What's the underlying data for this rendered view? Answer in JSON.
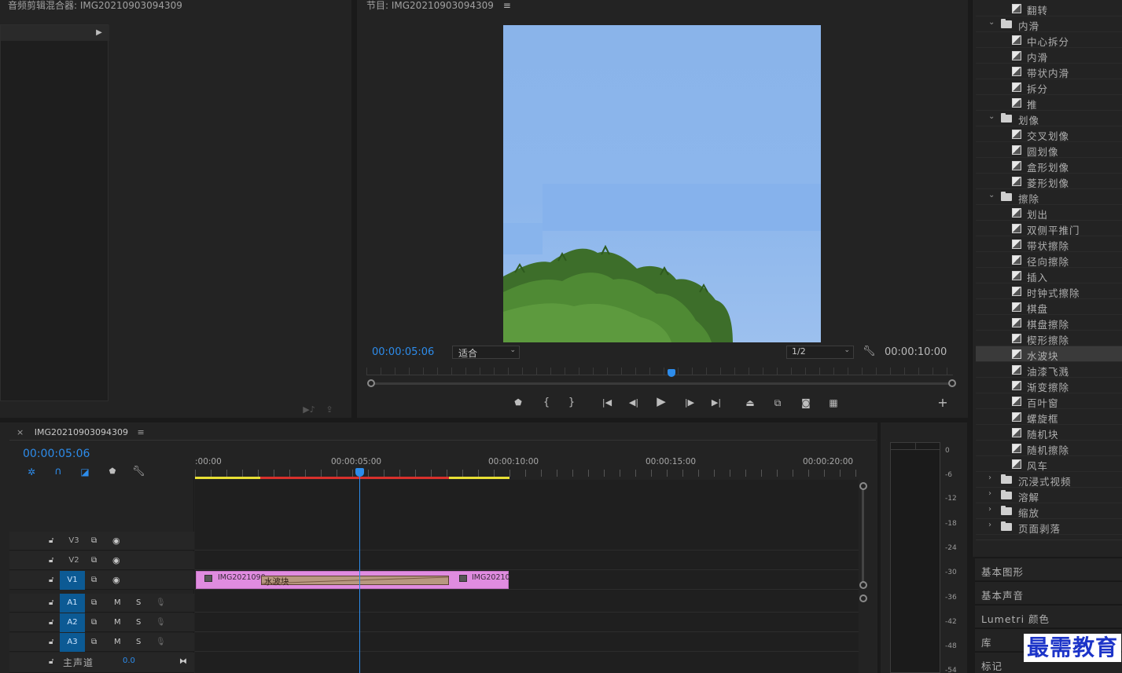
{
  "source_panel": {
    "title": "音频剪辑混合器: IMG20210903094309"
  },
  "program": {
    "title": "节目: IMG20210903094309",
    "timecode": "00:00:05:06",
    "fit": "适合",
    "quality": "1/2",
    "duration": "00:00:10:00",
    "playhead_fraction": 0.52
  },
  "timeline": {
    "tab_title": "IMG20210903094309",
    "timecode": "00:00:05:06",
    "ruler": [
      ":00:00",
      "00:00:05:00",
      "00:00:10:00",
      "00:00:15:00",
      "00:00:20:00"
    ],
    "tracks": {
      "v3": "V3",
      "v2": "V2",
      "v1": "V1",
      "a1": "A1",
      "a2": "A2",
      "a3": "A3",
      "m": "M",
      "s": "S",
      "master": "主声道",
      "master_val": "0.0"
    },
    "clip": {
      "left_name": "IMG2021090",
      "transition": "水波块",
      "right_name": "IMG20210"
    }
  },
  "meter": {
    "labels": [
      "0",
      "-6",
      "-12",
      "-18",
      "-24",
      "-30",
      "-36",
      "-42",
      "-48",
      "-54"
    ]
  },
  "effects_tree": [
    {
      "type": "item",
      "label": "翻转"
    },
    {
      "type": "folder",
      "label": "内滑",
      "open": true
    },
    {
      "type": "item",
      "label": "中心拆分"
    },
    {
      "type": "item",
      "label": "内滑"
    },
    {
      "type": "item",
      "label": "带状内滑"
    },
    {
      "type": "item",
      "label": "拆分"
    },
    {
      "type": "item",
      "label": "推"
    },
    {
      "type": "folder",
      "label": "划像",
      "open": true
    },
    {
      "type": "item",
      "label": "交叉划像"
    },
    {
      "type": "item",
      "label": "圆划像"
    },
    {
      "type": "item",
      "label": "盒形划像"
    },
    {
      "type": "item",
      "label": "菱形划像"
    },
    {
      "type": "folder",
      "label": "擦除",
      "open": true
    },
    {
      "type": "item",
      "label": "划出"
    },
    {
      "type": "item",
      "label": "双侧平推门"
    },
    {
      "type": "item",
      "label": "带状擦除"
    },
    {
      "type": "item",
      "label": "径向擦除"
    },
    {
      "type": "item",
      "label": "插入"
    },
    {
      "type": "item",
      "label": "时钟式擦除"
    },
    {
      "type": "item",
      "label": "棋盘"
    },
    {
      "type": "item",
      "label": "棋盘擦除"
    },
    {
      "type": "item",
      "label": "楔形擦除"
    },
    {
      "type": "item",
      "label": "水波块",
      "selected": true
    },
    {
      "type": "item",
      "label": "油漆飞溅"
    },
    {
      "type": "item",
      "label": "渐变擦除"
    },
    {
      "type": "item",
      "label": "百叶窗"
    },
    {
      "type": "item",
      "label": "螺旋框"
    },
    {
      "type": "item",
      "label": "随机块"
    },
    {
      "type": "item",
      "label": "随机擦除"
    },
    {
      "type": "item",
      "label": "风车"
    },
    {
      "type": "folder",
      "label": "沉浸式视频",
      "open": false
    },
    {
      "type": "folder",
      "label": "溶解",
      "open": false
    },
    {
      "type": "folder",
      "label": "缩放",
      "open": false
    },
    {
      "type": "folder",
      "label": "页面剥落",
      "open": false
    }
  ],
  "side_sections": [
    "基本图形",
    "基本声音",
    "Lumetri 颜色",
    "库",
    "标记"
  ],
  "watermark": "最需教育",
  "colors": {
    "accent": "#2d8ceb",
    "clip": "#e08ce0",
    "in_out": "#e8e034",
    "render_red": "#d8302c"
  }
}
